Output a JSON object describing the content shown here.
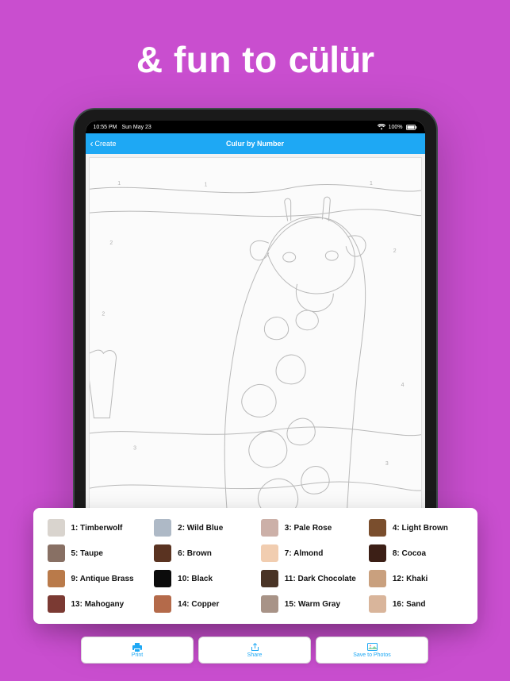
{
  "hero": {
    "prefix": "& fun to",
    "brand": "cülür"
  },
  "status": {
    "time": "10:55 PM",
    "date": "Sun May 23",
    "battery": "100%"
  },
  "nav": {
    "back_label": "Create",
    "title": "Culur by Number"
  },
  "palette": [
    {
      "num": "1",
      "name": "Timberwolf",
      "hex": "#d9d4ce"
    },
    {
      "num": "2",
      "name": "Wild Blue",
      "hex": "#aeb9c6"
    },
    {
      "num": "3",
      "name": "Pale Rose",
      "hex": "#ccb0a8"
    },
    {
      "num": "4",
      "name": "Light Brown",
      "hex": "#7a4e2d"
    },
    {
      "num": "5",
      "name": "Taupe",
      "hex": "#887064"
    },
    {
      "num": "6",
      "name": "Brown",
      "hex": "#5a3321"
    },
    {
      "num": "7",
      "name": "Almond",
      "hex": "#f1cdb0"
    },
    {
      "num": "8",
      "name": "Cocoa",
      "hex": "#3c1f16"
    },
    {
      "num": "9",
      "name": "Antique Brass",
      "hex": "#b97a4a"
    },
    {
      "num": "10",
      "name": "Black",
      "hex": "#0b0b0b"
    },
    {
      "num": "11",
      "name": "Dark Chocolate",
      "hex": "#4a3426"
    },
    {
      "num": "12",
      "name": "Khaki",
      "hex": "#c9a07e"
    },
    {
      "num": "13",
      "name": "Mahogany",
      "hex": "#7b3a33"
    },
    {
      "num": "14",
      "name": "Copper",
      "hex": "#b46a4a"
    },
    {
      "num": "15",
      "name": "Warm Gray",
      "hex": "#a89387"
    },
    {
      "num": "16",
      "name": "Sand",
      "hex": "#d9b59b"
    }
  ],
  "actions": {
    "print": "Print",
    "share": "Share",
    "save": "Save to Photos"
  }
}
